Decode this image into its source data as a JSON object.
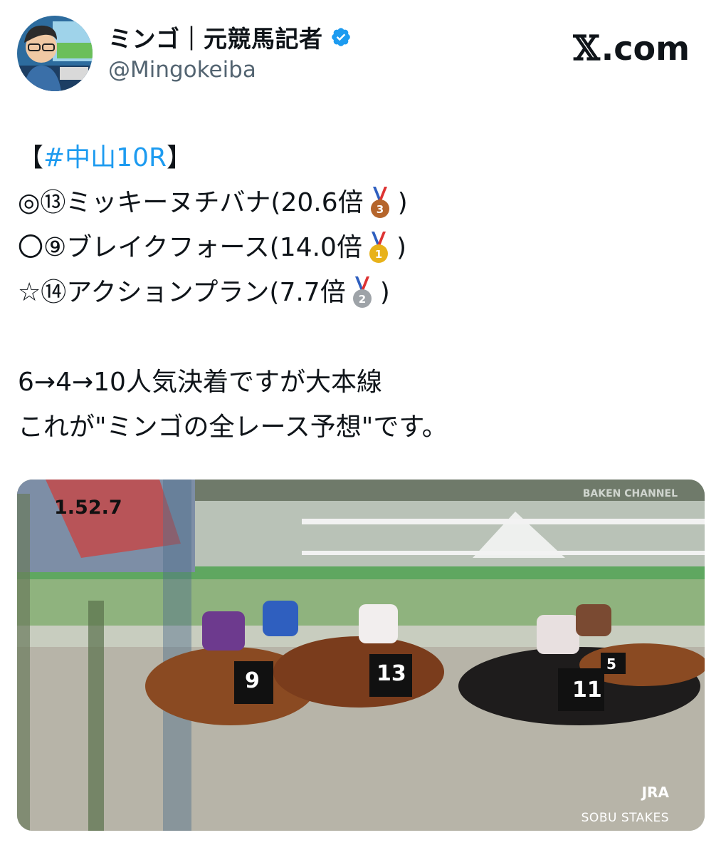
{
  "header": {
    "display_name": "ミンゴ｜元競馬記者",
    "handle": "@Mingokeiba",
    "brand_x": "𝕏",
    "brand_suffix": ".com"
  },
  "tweet": {
    "hashtag_line": {
      "open": "【",
      "tag": "#中山10R",
      "close": "】"
    },
    "picks": [
      {
        "text": "◎⑬ミッキーヌチバナ(20.6倍",
        "medal": "3",
        "medal_color": "#b5652b",
        "close": ")"
      },
      {
        "text": "〇⑨ブレイクフォース(14.0倍",
        "medal": "1",
        "medal_color": "#e8b21a",
        "close": ")"
      },
      {
        "text": "☆⑭アクションプラン(7.7倍",
        "medal": "2",
        "medal_color": "#9ea3a8",
        "close": ")"
      }
    ],
    "summary": "6→4→10人気決着ですが大本線",
    "tagline": "これが\"ミンゴの全レース予想\"です。"
  },
  "media": {
    "timer": "1.52.7",
    "corner_logo": "BAKEN CHANNEL",
    "jra": "JRA",
    "race_name": "SOBU STAKES",
    "saddle_numbers": [
      "9",
      "13",
      "11",
      "5"
    ],
    "accent": "#1d9bf0"
  }
}
